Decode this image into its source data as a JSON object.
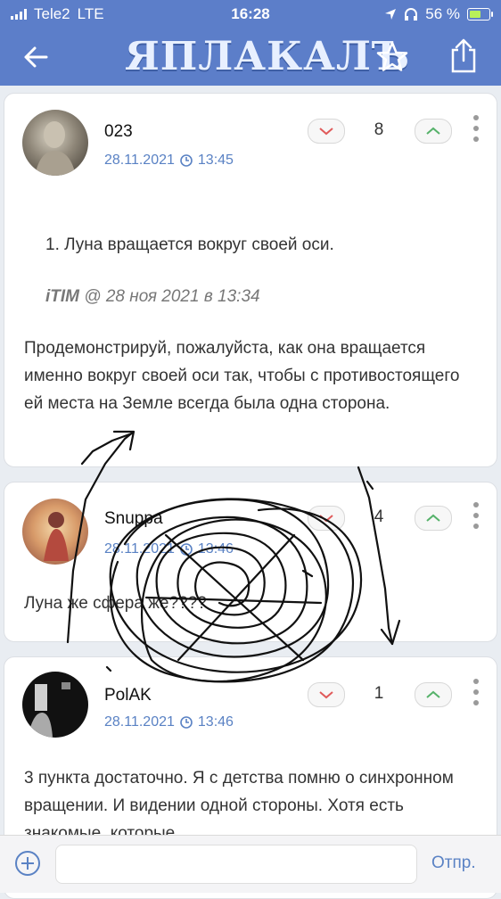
{
  "status_bar": {
    "carrier": "Tele2",
    "network": "LTE",
    "time": "16:28",
    "battery": "56 %"
  },
  "header": {
    "logo": "ЯПЛАКАЛЪ"
  },
  "posts": [
    {
      "author": "023",
      "date": "28.11.2021",
      "time": "13:45",
      "score": "8",
      "quote_text": "1. Луна вращается вокруг своей оси.",
      "quote_author": "iTIM",
      "quote_meta": "@ 28 ноя 2021 в 13:34",
      "body": "Продемонстрируй, пожалуйста, как она вращается именно вокруг своей оси так, чтобы с противостоящего ей места на Земле всегда была одна сторона."
    },
    {
      "author": "Snuppa",
      "date": "28.11.2021",
      "time": "13:46",
      "score": "4",
      "body": "Луна же сфера же????"
    },
    {
      "author": "PolAK",
      "date": "28.11.2021",
      "time": "13:46",
      "score": "1",
      "body": "3 пункта достаточно. Я с детства помню о синхронном вращении. И видении одной стороны. Хотя есть знакомые, которые"
    }
  ],
  "composer": {
    "send_label": "Отпр."
  },
  "colors": {
    "accent": "#5c7ec9",
    "link": "#5a82c4"
  }
}
